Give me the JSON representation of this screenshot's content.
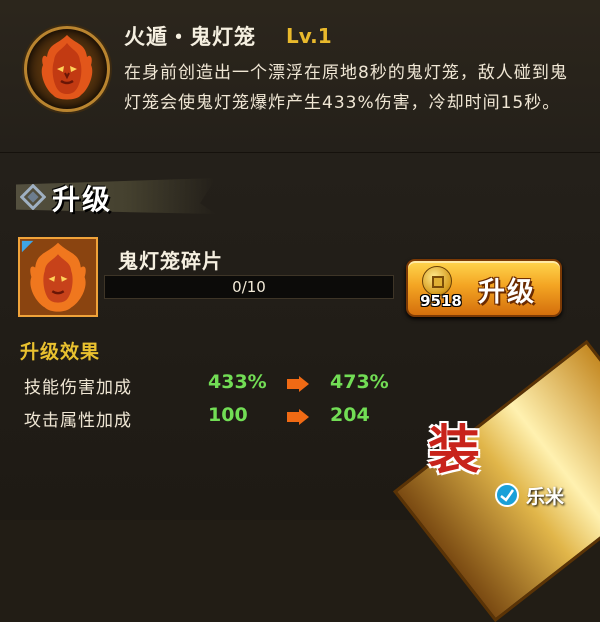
{
  "skill": {
    "name": "火遁・鬼灯笼",
    "level": "Lv.1",
    "description": "在身前创造出一个漂浮在原地8秒的鬼灯笼，敌人碰到鬼灯笼会使鬼灯笼爆炸产生433%伤害，冷却时间15秒。",
    "icon": "flame-demon-mask-icon"
  },
  "upgrade_section": {
    "title": "升级",
    "fragment": {
      "name": "鬼灯笼碎片",
      "icon": "flame-demon-mask-icon",
      "progress_text": "0/10",
      "progress_fraction": 0
    },
    "button": {
      "label": "升级",
      "cost": "9518",
      "icon": "copper-coin-icon"
    }
  },
  "effects": {
    "title": "升级效果",
    "rows": [
      {
        "label": "技能伤害加成",
        "current": "433%",
        "next": "473%"
      },
      {
        "label": "攻击属性加成",
        "current": "100",
        "next": "204"
      }
    ]
  },
  "corner_badge": {
    "glyph": "装"
  },
  "watermark": {
    "text": "乐米"
  },
  "colors": {
    "level": "#e9b92c",
    "section_title": "#e9c12f",
    "stat_value": "#72dd55",
    "arrow": "#f06a14",
    "button": "#f4a523"
  }
}
